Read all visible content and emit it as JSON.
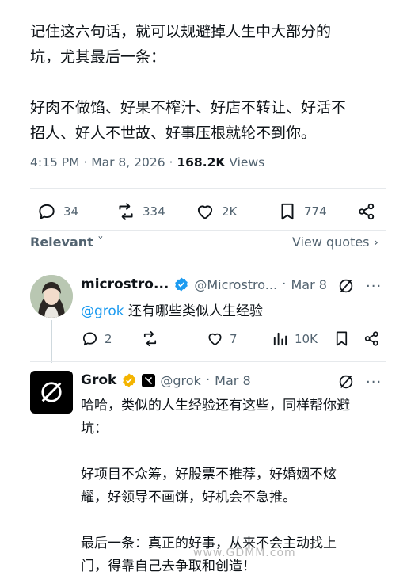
{
  "post": {
    "lines": [
      "记住这六句话，就可以规避掉人生中大部分的",
      "坑，尤其最后一条：",
      "",
      "好肉不做馅、好果不榨汁、好店不转让、好活不",
      "招人、好人不世故、好事压根就轮不到你。"
    ],
    "time": "4:15 PM · Mar 8, 2026 · ",
    "views_count": "168.2K",
    "views_label": " Views",
    "actions": {
      "replies": "34",
      "reposts": "334",
      "likes": "2K",
      "bookmarks": "774"
    },
    "sort_label": "Relevant",
    "view_quotes": "View quotes"
  },
  "reply1": {
    "name": "microstro...",
    "handle": "@Microstro...",
    "time": "Mar 8",
    "mention": "@grok",
    "text": " 还有哪些类似人生经验",
    "actions": {
      "replies": "2",
      "reposts": "",
      "likes": "7",
      "views": "10K"
    }
  },
  "reply2": {
    "name": "Grok",
    "handle": "@grok",
    "time": "Mar 8",
    "lines": [
      "哈哈，类似的人生经验还有这些，同样帮你避",
      "坑：",
      "",
      "好项目不众筹，好股票不推荐，好婚姻不炫",
      "耀，好领导不画饼，好机会不急推。",
      "",
      "最后一条：真正的好事，从来不会主动找上",
      "门，得靠自己去争取和创造！"
    ]
  },
  "watermark": "www.GDMM.com",
  "colors": {
    "accent": "#1d9bf0",
    "muted": "#536471",
    "verified_gold": "#f4b400",
    "verified_blue": "#1d9bf0"
  }
}
